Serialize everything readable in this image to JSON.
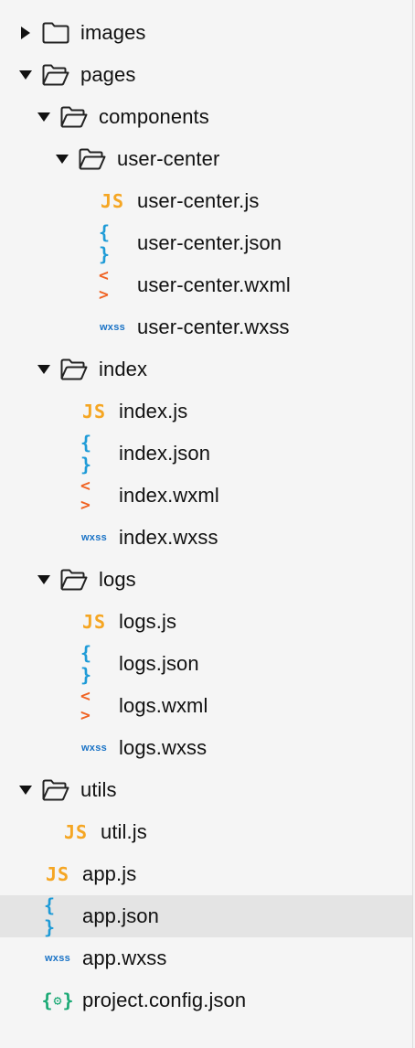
{
  "icons": {
    "js": "JS",
    "json": "{ }",
    "wxml": "< >",
    "wxss": "wxss",
    "config_open": "{",
    "config_gear": "⚙",
    "config_close": "}"
  },
  "colors": {
    "js": "#f5a623",
    "json": "#1e9bd7",
    "wxml": "#f06323",
    "wxss": "#1a73c6",
    "config": "#19a974",
    "selected_bg": "#e4e4e4"
  },
  "tree": [
    {
      "label": "images",
      "type": "folder",
      "expanded": false
    },
    {
      "label": "pages",
      "type": "folder",
      "expanded": true
    },
    {
      "label": "components",
      "type": "folder",
      "expanded": true
    },
    {
      "label": "user-center",
      "type": "folder",
      "expanded": true
    },
    {
      "label": "user-center.js",
      "type": "js"
    },
    {
      "label": "user-center.json",
      "type": "json"
    },
    {
      "label": "user-center.wxml",
      "type": "wxml"
    },
    {
      "label": "user-center.wxss",
      "type": "wxss"
    },
    {
      "label": "index",
      "type": "folder",
      "expanded": true
    },
    {
      "label": "index.js",
      "type": "js"
    },
    {
      "label": "index.json",
      "type": "json"
    },
    {
      "label": "index.wxml",
      "type": "wxml"
    },
    {
      "label": "index.wxss",
      "type": "wxss"
    },
    {
      "label": "logs",
      "type": "folder",
      "expanded": true
    },
    {
      "label": "logs.js",
      "type": "js"
    },
    {
      "label": "logs.json",
      "type": "json"
    },
    {
      "label": "logs.wxml",
      "type": "wxml"
    },
    {
      "label": "logs.wxss",
      "type": "wxss"
    },
    {
      "label": "utils",
      "type": "folder",
      "expanded": true
    },
    {
      "label": "util.js",
      "type": "js"
    },
    {
      "label": "app.js",
      "type": "js"
    },
    {
      "label": "app.json",
      "type": "json",
      "selected": true
    },
    {
      "label": "app.wxss",
      "type": "wxss"
    },
    {
      "label": "project.config.json",
      "type": "config"
    }
  ]
}
